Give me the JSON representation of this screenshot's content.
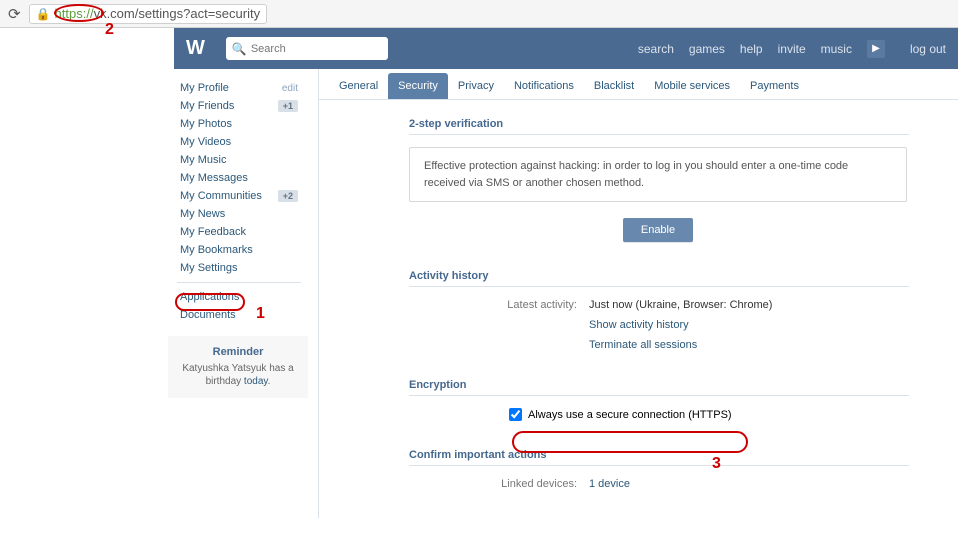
{
  "url": {
    "scheme": "https://",
    "rest": "vk.com/settings?act=security"
  },
  "topnav": {
    "search_placeholder": "Search",
    "links": [
      "search",
      "games",
      "help",
      "invite",
      "music"
    ],
    "logout": "log out"
  },
  "sidebar": {
    "items": [
      {
        "label": "My Profile",
        "extra": "edit",
        "extra_type": "edit"
      },
      {
        "label": "My Friends",
        "extra": "+1",
        "extra_type": "badge"
      },
      {
        "label": "My Photos"
      },
      {
        "label": "My Videos"
      },
      {
        "label": "My Music"
      },
      {
        "label": "My Messages"
      },
      {
        "label": "My Communities",
        "extra": "+2",
        "extra_type": "badge"
      },
      {
        "label": "My News"
      },
      {
        "label": "My Feedback"
      },
      {
        "label": "My Bookmarks"
      },
      {
        "label": "My Settings"
      }
    ],
    "extra": [
      {
        "label": "Applications"
      },
      {
        "label": "Documents"
      }
    ]
  },
  "reminder": {
    "title": "Reminder",
    "text_before": "Katyushka Yatsyuk has a birthday ",
    "today": "today",
    "dot": "."
  },
  "tabs": [
    "General",
    "Security",
    "Privacy",
    "Notifications",
    "Blacklist",
    "Mobile services",
    "Payments"
  ],
  "active_tab": 1,
  "sections": {
    "twostep": {
      "title": "2-step verification",
      "info": "Effective protection against hacking: in order to log in you should enter a one-time code received via SMS or another chosen method.",
      "enable": "Enable"
    },
    "activity": {
      "title": "Activity history",
      "latest_label": "Latest activity:",
      "latest_value": "Just now (Ukraine, Browser: Chrome)",
      "show_link": "Show activity history",
      "terminate_link": "Terminate all sessions"
    },
    "encryption": {
      "title": "Encryption",
      "checkbox_label": "Always use a secure connection (HTTPS)"
    },
    "confirm": {
      "title": "Confirm important actions",
      "linked_label": "Linked devices:",
      "linked_value": "1 device"
    }
  },
  "annotations": {
    "n1": "1",
    "n2": "2",
    "n3": "3"
  }
}
